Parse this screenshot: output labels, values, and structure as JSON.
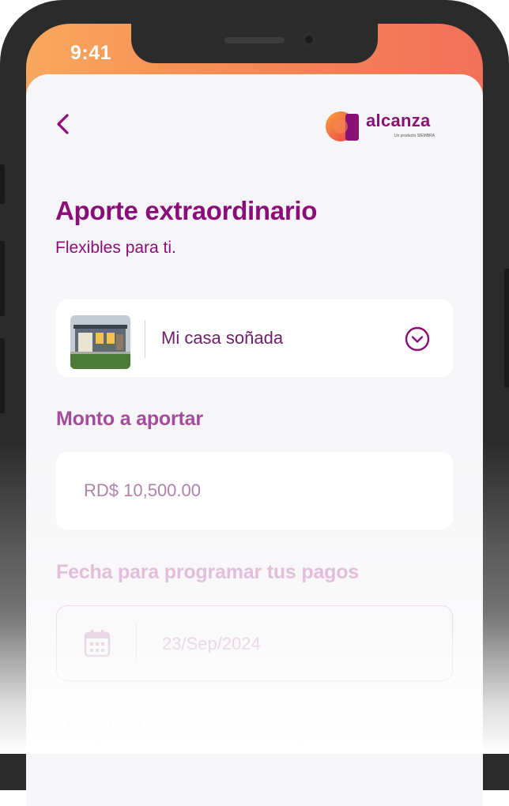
{
  "status_bar": {
    "time": "9:41"
  },
  "header": {
    "back_icon": "chevron-left-icon",
    "logo_text": "alcanza",
    "logo_subtext": "Un producto SIEMBRA"
  },
  "page": {
    "title": "Aporte extraordinario",
    "subtitle": "Flexibles para ti."
  },
  "goal_selector": {
    "label": "Mi casa soñada",
    "icon": "chevron-down-circle-icon"
  },
  "amount": {
    "label": "Monto a aportar",
    "value": "RD$ 10,500.00"
  },
  "date": {
    "label": "Fecha para programar tus pagos",
    "value": "23/Sep/2024",
    "icon": "calendar-icon"
  },
  "payment_method": {
    "label": "Método de pago"
  },
  "colors": {
    "primary": "#8b0d7a",
    "accent_orange": "#f58a55",
    "background": "#f6f5f7"
  }
}
